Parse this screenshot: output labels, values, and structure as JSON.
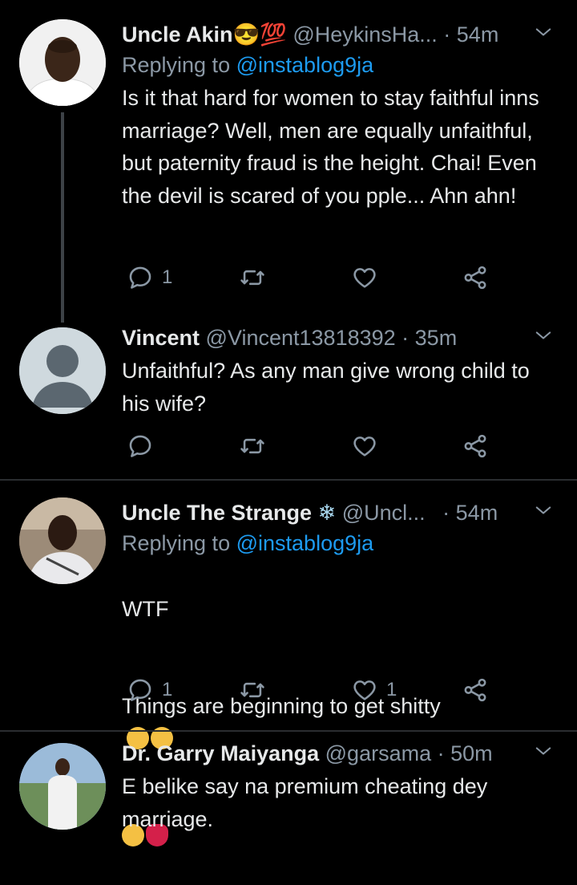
{
  "tweets": [
    {
      "name": "Uncle Akin",
      "name_emoji": "😎💯",
      "handle": "@HeykinsHa...",
      "time": "· 54m",
      "replying_label": "Replying to",
      "replying_to": "@instablog9ja",
      "text": "Is it that hard for women to stay faithful inns marriage? Well, men are equally unfaithful, but paternity fraud is the height. Chai! Even the devil is scared of you pple... Ahn ahn!",
      "reply_count": "1",
      "retweet_count": "",
      "like_count": ""
    },
    {
      "name": "Vincent",
      "handle": "@Vincent13818392",
      "time": "· 35m",
      "text": "Unfaithful? As any man give wrong child to his wife?",
      "reply_count": "",
      "retweet_count": "",
      "like_count": ""
    },
    {
      "name": "Uncle The Strange",
      "name_emoji": "❄",
      "handle": "@Uncl...",
      "time": "· 54m",
      "replying_label": "Replying to",
      "replying_to": "@instablog9ja",
      "text_line1": "WTF",
      "text_line2": "Things are beginning to get shitty",
      "reply_count": "1",
      "retweet_count": "",
      "like_count": "1"
    },
    {
      "name": "Dr. Garry Maiyanga",
      "handle": "@garsama",
      "time": "· 50m",
      "text": "E belike say na premium cheating dey marriage."
    }
  ],
  "colors": {
    "background": "#000000",
    "text": "#e7e9ea",
    "muted": "#8b98a5",
    "link": "#1d9bf0"
  },
  "icons": [
    "reply-icon",
    "retweet-icon",
    "like-icon",
    "share-icon",
    "chevron-down-icon"
  ]
}
